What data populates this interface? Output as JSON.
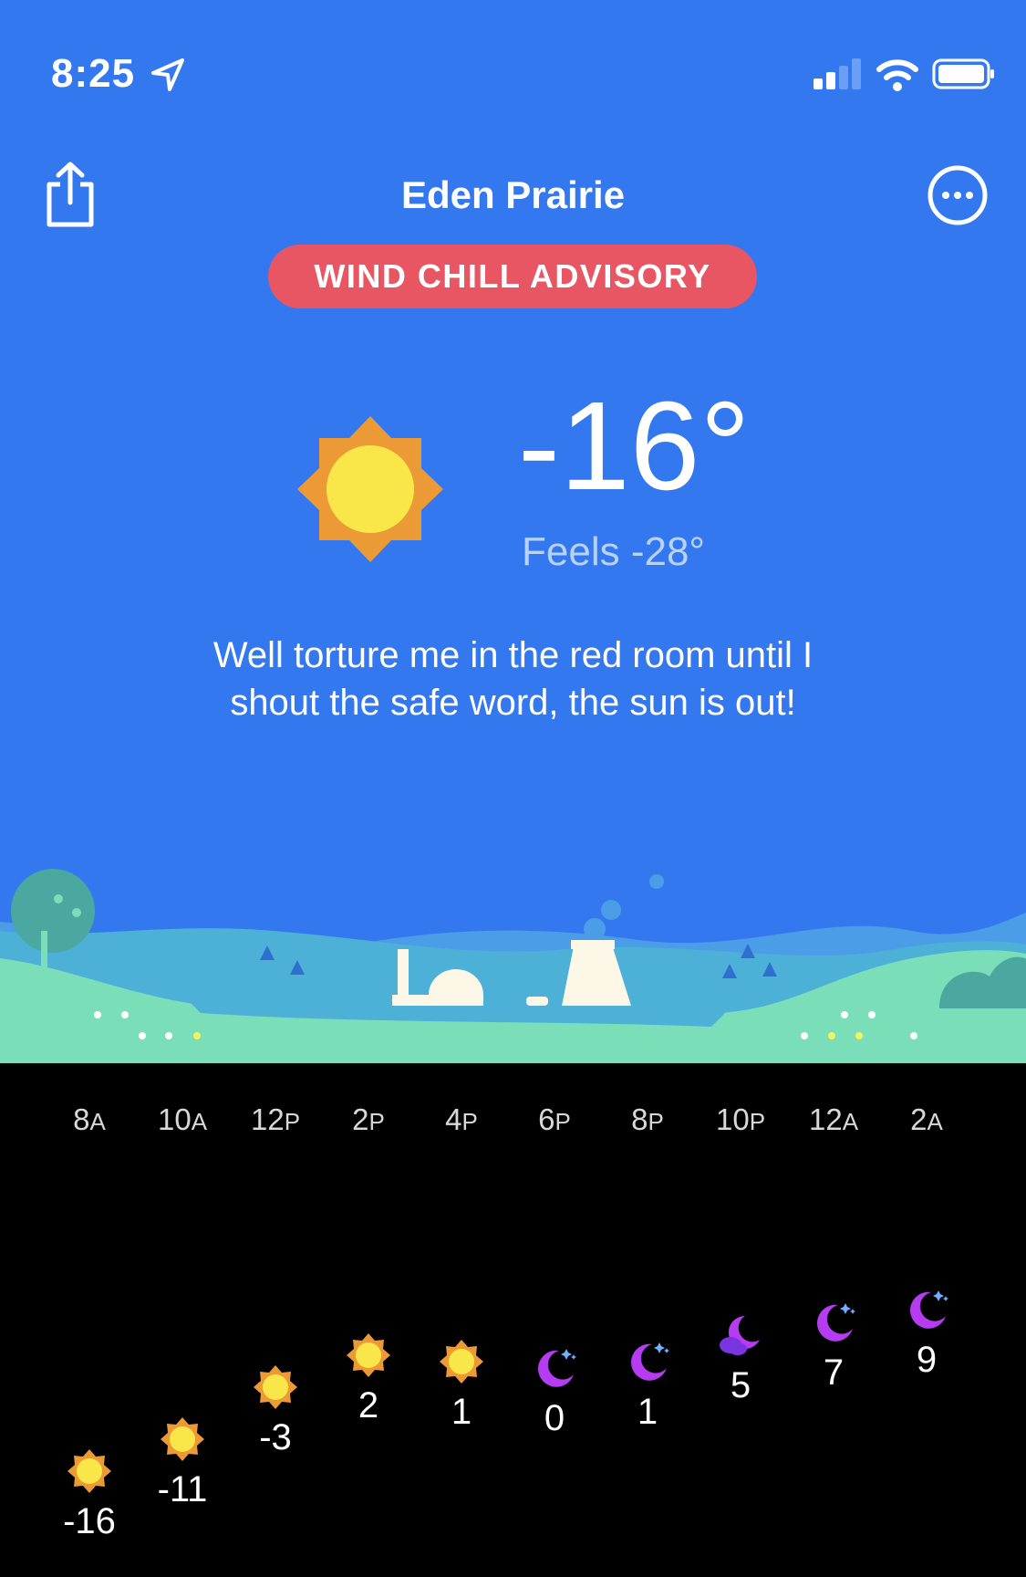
{
  "status_bar": {
    "time": "8:25"
  },
  "header": {
    "city": "Eden Prairie",
    "advisory": "WIND CHILL ADVISORY"
  },
  "current": {
    "icon": "sun-icon",
    "temperature": "-16°",
    "feels_like": "Feels -28°",
    "quip_line1": "Well torture me in the red room until I",
    "quip_line2": "shout the safe word, the sun is out!"
  },
  "forecast": {
    "hours": [
      {
        "hour": "8",
        "ampm": "A",
        "temp": "-16",
        "icon": "sun-icon"
      },
      {
        "hour": "10",
        "ampm": "A",
        "temp": "-11",
        "icon": "sun-icon"
      },
      {
        "hour": "12",
        "ampm": "P",
        "temp": "-3",
        "icon": "sun-icon"
      },
      {
        "hour": "2",
        "ampm": "P",
        "temp": "2",
        "icon": "sun-icon"
      },
      {
        "hour": "4",
        "ampm": "P",
        "temp": "1",
        "icon": "sun-icon"
      },
      {
        "hour": "6",
        "ampm": "P",
        "temp": "0",
        "icon": "moon-stars-icon"
      },
      {
        "hour": "8",
        "ampm": "P",
        "temp": "1",
        "icon": "moon-stars-icon"
      },
      {
        "hour": "10",
        "ampm": "P",
        "temp": "5",
        "icon": "moon-cloud-icon"
      },
      {
        "hour": "12",
        "ampm": "A",
        "temp": "7",
        "icon": "moon-stars-icon"
      },
      {
        "hour": "2",
        "ampm": "A",
        "temp": "9",
        "icon": "moon-stars-icon"
      }
    ]
  },
  "colors": {
    "sky": "#3478f0",
    "advisory": "#e85663",
    "sun_outer": "#ec9a36",
    "sun_inner": "#f9e74a",
    "moon": "#b53cf0"
  }
}
